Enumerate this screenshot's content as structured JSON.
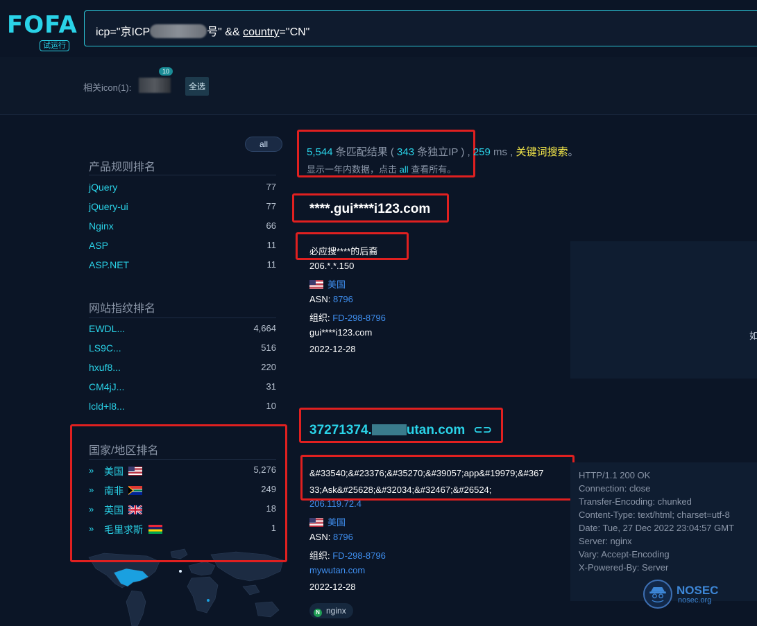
{
  "header": {
    "logo": "FOFA",
    "badge": "试运行",
    "query_part1": "icp=\"京ICP",
    "query_part2": "号\" && ",
    "query_part3": "country",
    "query_part4": "=\"CN\""
  },
  "icons": {
    "label": "相关icon(1):",
    "count": "10",
    "select_all": "全选"
  },
  "sidebar": {
    "all_label": "all",
    "product_title": "产品规则排名",
    "products": [
      {
        "name": "jQuery",
        "count": "77"
      },
      {
        "name": "jQuery-ui",
        "count": "77"
      },
      {
        "name": "Nginx",
        "count": "66"
      },
      {
        "name": "ASP",
        "count": "11"
      },
      {
        "name": "ASP.NET",
        "count": "11"
      }
    ],
    "fingerprint_title": "网站指纹排名",
    "fingerprints": [
      {
        "name": "EWDL...",
        "count": "4,664"
      },
      {
        "name": "LS9C...",
        "count": "516"
      },
      {
        "name": "hxuf8...",
        "count": "220"
      },
      {
        "name": "CM4jJ...",
        "count": "31"
      },
      {
        "name": "lcld+l8...",
        "count": "10"
      }
    ],
    "country_title": "国家/地区排名",
    "countries": [
      {
        "name": "美国",
        "count": "5,276"
      },
      {
        "name": "南非",
        "count": "249"
      },
      {
        "name": "英国",
        "count": "18"
      },
      {
        "name": "毛里求斯",
        "count": "1"
      }
    ]
  },
  "stats": {
    "results": "5,544",
    "results_label": " 条匹配结果 ( ",
    "ips": "343",
    "ips_label": " 条独立IP ) , ",
    "ms": "259",
    "ms_label": " ms , ",
    "keyword": "关键词搜索",
    "keyword_end": "。",
    "sub_prefix": "显示一年内数据，点击 ",
    "sub_all": "all",
    "sub_suffix": " 查看所有。"
  },
  "result1": {
    "host": "****.gui****i123.com",
    "title": "必应搜****的后裔",
    "ip": "206.*.*.150",
    "country": "美国",
    "asn_label": "ASN: ",
    "asn": "8796",
    "org_label": "组织: ",
    "org": "FD-298-8796",
    "domain": "gui****i123.com",
    "date": "2022-12-28",
    "panel_char": "如"
  },
  "result2": {
    "host_prefix": "37271374.",
    "host_suffix": "utan.com",
    "entity": "&#33540;&#23376;&#35270;&#39057;app&#19979;&#36733;Ask&#25628;&#32034;&#32467;&#26524;",
    "ip": "206.119.72.4",
    "country": "美国",
    "asn_label": "ASN: ",
    "asn": "8796",
    "org_label": "组织: ",
    "org": "FD-298-8796",
    "domain": "mywutan.com",
    "date": "2022-12-28",
    "tag": "nginx",
    "headers": [
      "HTTP/1.1 200 OK",
      "Connection: close",
      "Transfer-Encoding: chunked",
      "Content-Type: text/html; charset=utf-8",
      "Date: Tue, 27 Dec 2022 23:04:57 GMT",
      "Server: nginx",
      "Vary: Accept-Encoding",
      "X-Powered-By: Server"
    ]
  },
  "watermark": {
    "title": "NOSEC",
    "sub": "nosec.org"
  }
}
